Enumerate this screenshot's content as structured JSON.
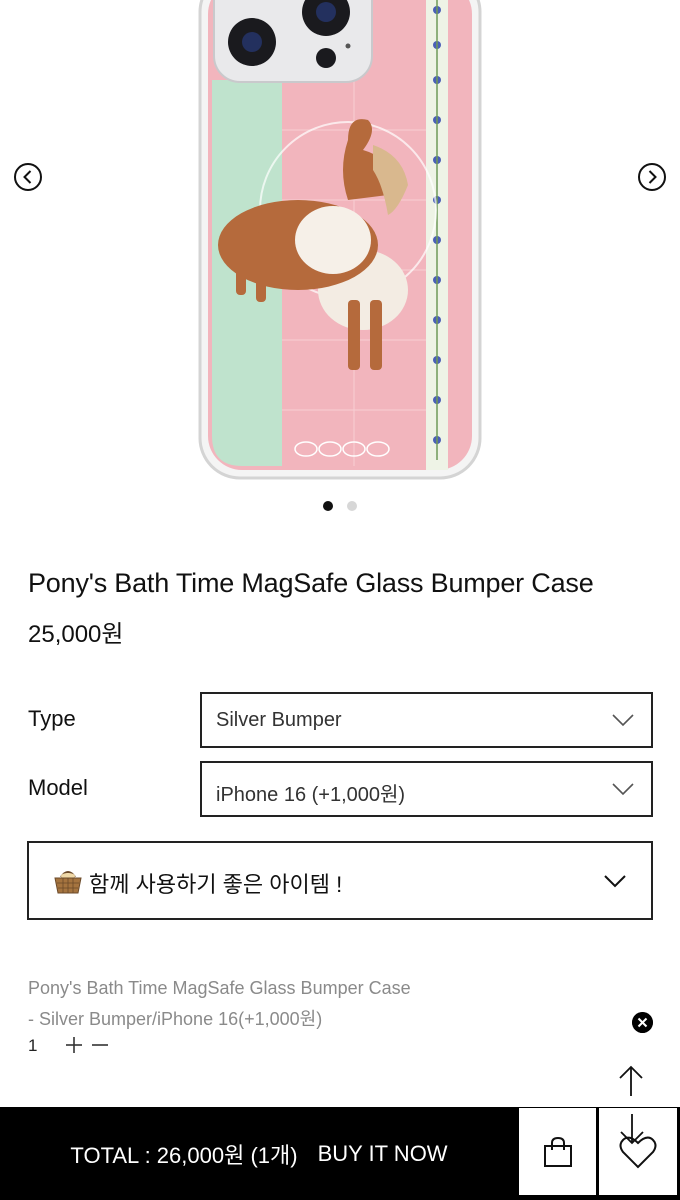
{
  "carousel": {
    "prev_icon": "chevron-left-circle-icon",
    "next_icon": "chevron-right-circle-icon",
    "slide_count": 2,
    "active_slide": 1
  },
  "product": {
    "title": "Pony's Bath Time MagSafe Glass Bumper Case",
    "price": "25,000원"
  },
  "options": {
    "type_label": "Type",
    "type_value": "Silver Bumper",
    "model_label": "Model",
    "model_value": "iPhone 16 (+1,000원)"
  },
  "related": {
    "icon": "basket-icon",
    "label": "함께 사용하기 좋은 아이템 !"
  },
  "selection": {
    "name": "Pony's Bath Time MagSafe Glass Bumper Case",
    "options": "- Silver Bumper/iPhone 16(+1,000원)",
    "quantity": "1",
    "plus": "+",
    "minus": "−"
  },
  "bottom_bar": {
    "total": "TOTAL : 26,000원 (1개)",
    "buy_now": "BUY IT NOW",
    "cart_icon": "shopping-bag-icon",
    "wish_icon": "heart-icon"
  },
  "colors": {
    "case_pink": "#f2b5bd",
    "case_mint": "#bfe3cd",
    "bar_black": "#000000"
  }
}
